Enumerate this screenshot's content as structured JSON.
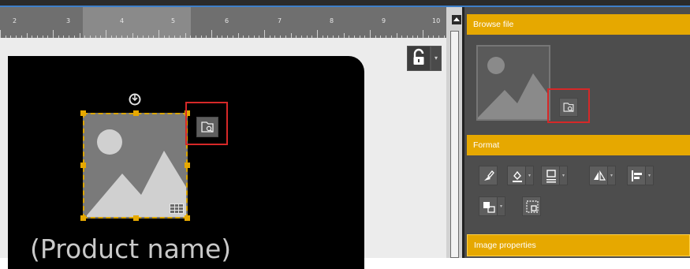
{
  "ruler": {
    "labels": [
      "2",
      "3",
      "4",
      "5",
      "6",
      "7",
      "8",
      "9",
      "10"
    ]
  },
  "canvas": {
    "product_text": "(Product name)"
  },
  "panel": {
    "browse_section": "Browse file",
    "format_section": "Format",
    "image_properties_section": "Image properties"
  },
  "icons": {
    "lock": "unlock-icon",
    "rotate": "rotate-handle-icon",
    "browse": "browse-file-icon",
    "image": "image-placeholder-icon",
    "format_tools": [
      "paint-brush-icon",
      "fill-bucket-icon",
      "border-icon",
      "flip-icon",
      "align-left-icon",
      "arrange-icon",
      "resize-icon"
    ]
  },
  "colors": {
    "accent": "#e6a800",
    "highlight": "#d62828",
    "panel_bg": "#4d4d4d",
    "label_bg": "#000000"
  }
}
